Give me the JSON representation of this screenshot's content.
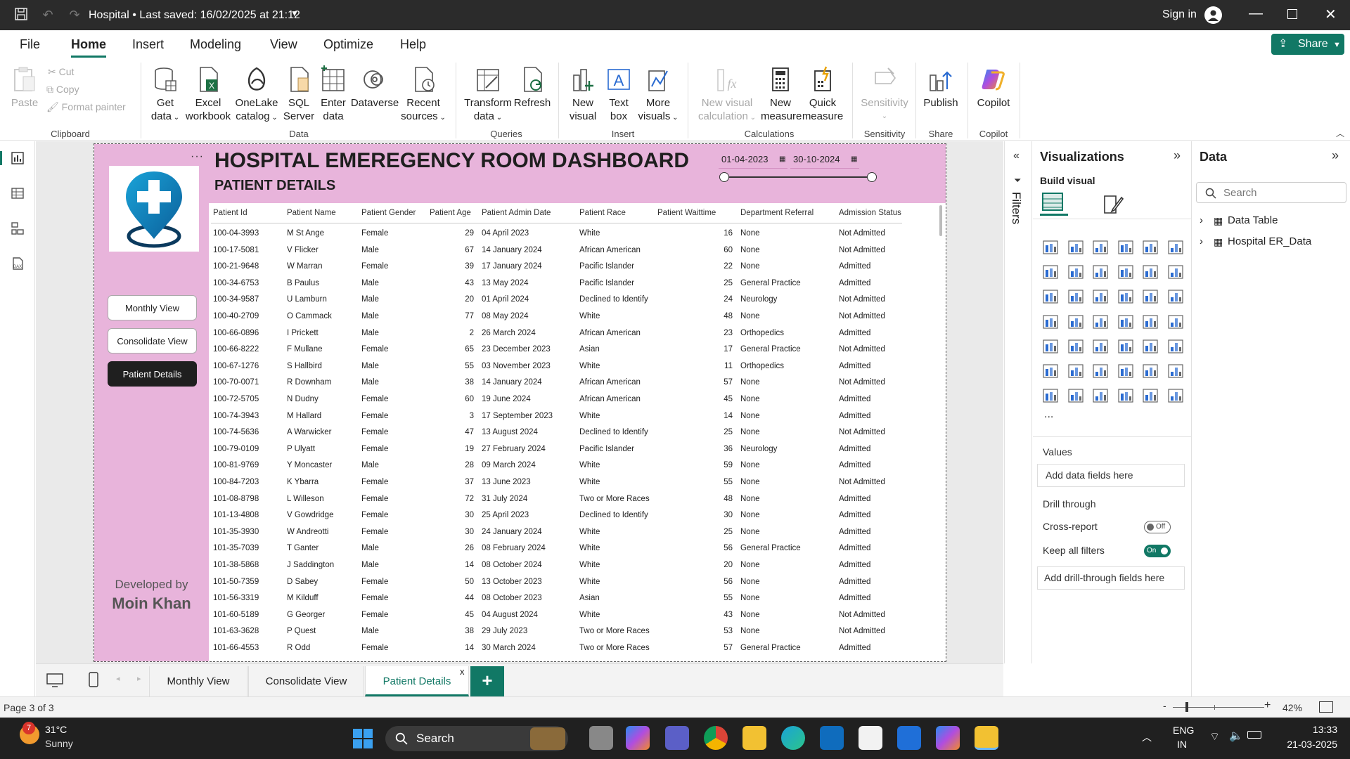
{
  "titlebar": {
    "title": "Hospital • Last saved: 16/02/2025 at 21:12",
    "sign_in": "Sign in"
  },
  "ribbon_tabs": [
    "File",
    "Home",
    "Insert",
    "Modeling",
    "View",
    "Optimize",
    "Help"
  ],
  "share_label": "Share",
  "ribbon": {
    "clipboard": {
      "paste": "Paste",
      "cut": "Cut",
      "copy": "Copy",
      "format_painter": "Format painter",
      "group": "Clipboard"
    },
    "data": {
      "get_data": [
        "Get",
        "data"
      ],
      "excel": [
        "Excel",
        "workbook"
      ],
      "onelake": [
        "OneLake",
        "catalog"
      ],
      "sql": [
        "SQL",
        "Server"
      ],
      "enter": [
        "Enter",
        "data"
      ],
      "dataverse": "Dataverse",
      "recent": [
        "Recent",
        "sources"
      ],
      "group": "Data"
    },
    "queries": {
      "transform": [
        "Transform",
        "data"
      ],
      "refresh": "Refresh",
      "group": "Queries"
    },
    "insert": {
      "new_visual": [
        "New",
        "visual"
      ],
      "text_box": [
        "Text",
        "box"
      ],
      "more_visuals": [
        "More",
        "visuals"
      ],
      "group": "Insert"
    },
    "calculations": {
      "new_visual_calc": [
        "New visual",
        "calculation"
      ],
      "new_measure": [
        "New",
        "measure"
      ],
      "quick_measure": [
        "Quick",
        "measure"
      ],
      "group": "Calculations"
    },
    "sensitivity": {
      "label": "Sensitivity",
      "group": "Sensitivity"
    },
    "share": {
      "publish": "Publish",
      "group": "Share"
    },
    "copilot": {
      "label": "Copilot",
      "group": "Copilot"
    }
  },
  "report": {
    "title": "HOSPITAL EMEREGENCY ROOM DASHBOARD",
    "subtitle": "PATIENT DETAILS",
    "date_from": "01-04-2023",
    "date_to": "30-10-2024",
    "nav": [
      "Monthly View",
      "Consolidate View",
      "Patient Details"
    ],
    "developed_by": "Developed by",
    "author": "Moin Khan"
  },
  "table": {
    "columns": [
      "Patient Id",
      "Patient Name",
      "Patient Gender",
      "Patient Age",
      "Patient Admin Date",
      "Patient Race",
      "Patient Waittime",
      "Department Referral",
      "Admission Status"
    ],
    "rows": [
      [
        "100-04-3993",
        "M St Ange",
        "Female",
        "29",
        "04 April 2023",
        "White",
        "16",
        "None",
        "Not Admitted"
      ],
      [
        "100-17-5081",
        "V Flicker",
        "Male",
        "67",
        "14 January 2024",
        "African American",
        "60",
        "None",
        "Not Admitted"
      ],
      [
        "100-21-9648",
        "W Marran",
        "Female",
        "39",
        "17 January 2024",
        "Pacific Islander",
        "22",
        "None",
        "Admitted"
      ],
      [
        "100-34-6753",
        "B Paulus",
        "Male",
        "43",
        "13 May 2024",
        "Pacific Islander",
        "25",
        "General Practice",
        "Admitted"
      ],
      [
        "100-34-9587",
        "U Lamburn",
        "Male",
        "20",
        "01 April 2024",
        "Declined to Identify",
        "24",
        "Neurology",
        "Not Admitted"
      ],
      [
        "100-40-2709",
        "O Cammack",
        "Male",
        "77",
        "08 May 2024",
        "White",
        "48",
        "None",
        "Not Admitted"
      ],
      [
        "100-66-0896",
        "I Prickett",
        "Male",
        "2",
        "26 March 2024",
        "African American",
        "23",
        "Orthopedics",
        "Admitted"
      ],
      [
        "100-66-8222",
        "F Mullane",
        "Female",
        "65",
        "23 December 2023",
        "Asian",
        "17",
        "General Practice",
        "Not Admitted"
      ],
      [
        "100-67-1276",
        "S Hallbird",
        "Male",
        "55",
        "03 November 2023",
        "White",
        "11",
        "Orthopedics",
        "Admitted"
      ],
      [
        "100-70-0071",
        "R Downham",
        "Male",
        "38",
        "14 January 2024",
        "African American",
        "57",
        "None",
        "Not Admitted"
      ],
      [
        "100-72-5705",
        "N Dudny",
        "Female",
        "60",
        "19 June 2024",
        "African American",
        "45",
        "None",
        "Admitted"
      ],
      [
        "100-74-3943",
        "M Hallard",
        "Female",
        "3",
        "17 September 2023",
        "White",
        "14",
        "None",
        "Admitted"
      ],
      [
        "100-74-5636",
        "A Warwicker",
        "Female",
        "47",
        "13 August 2024",
        "Declined to Identify",
        "25",
        "None",
        "Not Admitted"
      ],
      [
        "100-79-0109",
        "P Ulyatt",
        "Female",
        "19",
        "27 February 2024",
        "Pacific Islander",
        "36",
        "Neurology",
        "Admitted"
      ],
      [
        "100-81-9769",
        "Y Moncaster",
        "Male",
        "28",
        "09 March 2024",
        "White",
        "59",
        "None",
        "Admitted"
      ],
      [
        "100-84-7203",
        "K Ybarra",
        "Female",
        "37",
        "13 June 2023",
        "White",
        "55",
        "None",
        "Not Admitted"
      ],
      [
        "101-08-8798",
        "L Willeson",
        "Female",
        "72",
        "31 July 2024",
        "Two or More Races",
        "48",
        "None",
        "Admitted"
      ],
      [
        "101-13-4808",
        "V Gowdridge",
        "Female",
        "30",
        "25 April 2023",
        "Declined to Identify",
        "30",
        "None",
        "Admitted"
      ],
      [
        "101-35-3930",
        "W Andreotti",
        "Female",
        "30",
        "24 January 2024",
        "White",
        "25",
        "None",
        "Admitted"
      ],
      [
        "101-35-7039",
        "T Ganter",
        "Male",
        "26",
        "08 February 2024",
        "White",
        "56",
        "General Practice",
        "Admitted"
      ],
      [
        "101-38-5868",
        "J Saddington",
        "Male",
        "14",
        "08 October 2024",
        "White",
        "20",
        "None",
        "Admitted"
      ],
      [
        "101-50-7359",
        "D Sabey",
        "Female",
        "50",
        "13 October 2023",
        "White",
        "56",
        "None",
        "Admitted"
      ],
      [
        "101-56-3319",
        "M Kilduff",
        "Female",
        "44",
        "08 October 2023",
        "Asian",
        "55",
        "None",
        "Admitted"
      ],
      [
        "101-60-5189",
        "G Georger",
        "Female",
        "45",
        "04 August 2024",
        "White",
        "43",
        "None",
        "Not Admitted"
      ],
      [
        "101-63-3628",
        "P Quest",
        "Male",
        "38",
        "29 July 2023",
        "Two or More Races",
        "53",
        "None",
        "Not Admitted"
      ],
      [
        "101-66-4553",
        "R Odd",
        "Female",
        "14",
        "30 March 2024",
        "Two or More Races",
        "57",
        "General Practice",
        "Admitted"
      ]
    ]
  },
  "filters_label": "Filters",
  "visualizations": {
    "title": "Visualizations",
    "build_visual": "Build visual",
    "values": "Values",
    "add_data_fields": "Add data fields here",
    "drill_through": "Drill through",
    "cross_report": "Cross-report",
    "cross_report_state": "Off",
    "keep_all_filters": "Keep all filters",
    "keep_all_filters_state": "On",
    "add_drill_fields": "Add drill-through fields here",
    "more": "..."
  },
  "data_pane": {
    "title": "Data",
    "search_placeholder": "Search",
    "tables": [
      "Data Table",
      "Hospital ER_Data"
    ]
  },
  "pages": [
    "Monthly View",
    "Consolidate View",
    "Patient Details"
  ],
  "page_add": "+",
  "page_close": "x",
  "status": {
    "page": "Page 3 of 3",
    "zoom": "42%",
    "zoom_minus": "-",
    "zoom_plus": "+"
  },
  "taskbar": {
    "weather_temp": "31°C",
    "weather_desc": "Sunny",
    "weather_badge": "7",
    "search": "Search",
    "lang1": "ENG",
    "lang2": "IN",
    "time": "13:33",
    "date": "21-03-2025"
  },
  "colors": {
    "accent": "#117865",
    "report_pink": "#e8b4db",
    "dark": "#2b2b2b"
  }
}
